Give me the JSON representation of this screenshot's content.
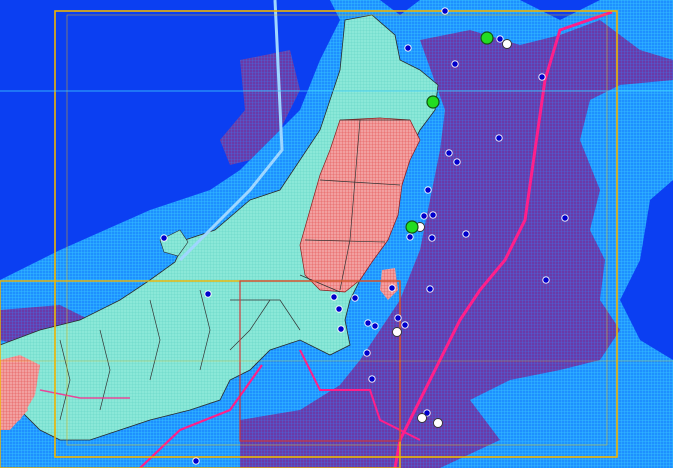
{
  "map": {
    "style": "earthquake hazard grid map (Tohoku / Kanto, Japan)",
    "legend_colors": {
      "sea_background": "#0b3ff2",
      "offshore_light_grid": "#1e90ff",
      "offshore_dense_grid": "#6a3aa8",
      "land_low": "#7fe3d3",
      "land_high": "#f08c8c",
      "prefecture_border": "#333333",
      "bounding_box": "#f0b400",
      "trench_line": "#ff1f8a",
      "fault_line": "#9fd6ff"
    },
    "markers": [
      {
        "kind": "station",
        "color": "#0000cc"
      },
      {
        "kind": "epicenter_green",
        "color": "#22dd22"
      },
      {
        "kind": "epicenter_white",
        "color": "#ffffff"
      }
    ]
  }
}
